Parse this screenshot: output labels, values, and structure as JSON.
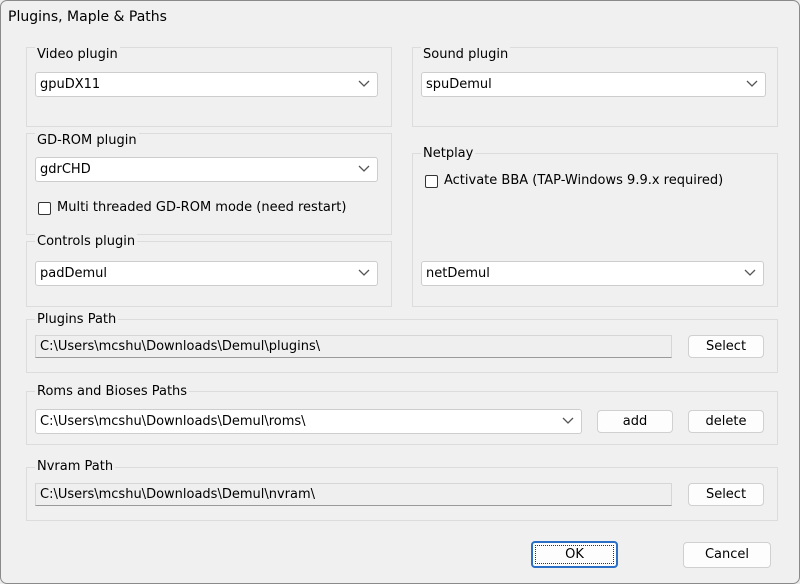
{
  "window": {
    "title": "Plugins, Maple & Paths"
  },
  "video": {
    "label": "Video plugin",
    "value": "gpuDX11"
  },
  "sound": {
    "label": "Sound plugin",
    "value": "spuDemul"
  },
  "gdrom": {
    "label": "GD-ROM plugin",
    "value": "gdrCHD",
    "multithread_label": "Multi threaded GD-ROM mode (need restart)",
    "multithread_checked": false
  },
  "netplay": {
    "label": "Netplay",
    "bba_label": "Activate BBA (TAP-Windows 9.9.x required)",
    "bba_checked": false,
    "value": "netDemul"
  },
  "controls": {
    "label": "Controls plugin",
    "value": "padDemul"
  },
  "plugins_path": {
    "label": "Plugins Path",
    "value": "C:\\Users\\mcshu\\Downloads\\Demul\\plugins\\",
    "select_label": "Select"
  },
  "roms_path": {
    "label": "Roms and Bioses Paths",
    "value": "C:\\Users\\mcshu\\Downloads\\Demul\\roms\\",
    "add_label": "add",
    "delete_label": "delete"
  },
  "nvram_path": {
    "label": "Nvram Path",
    "value": "C:\\Users\\mcshu\\Downloads\\Demul\\nvram\\",
    "select_label": "Select"
  },
  "dialog": {
    "ok_label": "OK",
    "cancel_label": "Cancel"
  },
  "icons": {
    "dropdown": "chevron-down-icon",
    "checkbox": "checkbox-icon"
  }
}
